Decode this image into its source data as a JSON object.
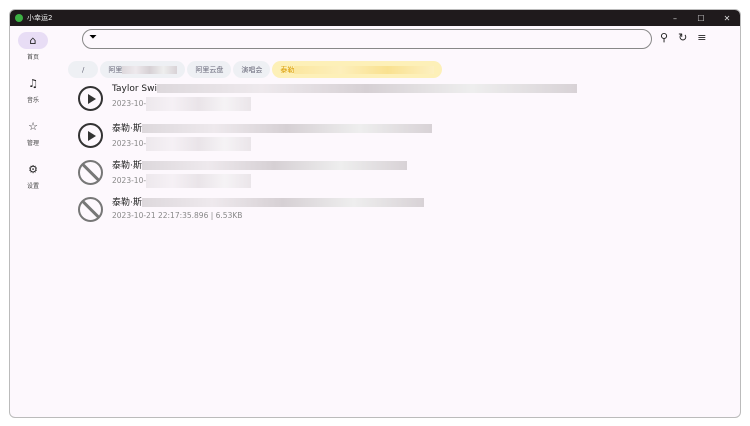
{
  "app": {
    "title": "小幸运2"
  },
  "window_controls": [
    "–",
    "☐",
    "✕"
  ],
  "sidebar": {
    "items": [
      {
        "label": "首页",
        "icon": "home-icon"
      },
      {
        "label": "音乐",
        "icon": "music-library-icon"
      },
      {
        "label": "管理",
        "icon": "star-icon"
      },
      {
        "label": "设置",
        "icon": "gear-icon"
      }
    ]
  },
  "toolbar": {
    "search_placeholder": "",
    "search_value": ""
  },
  "breadcrumbs": [
    "/",
    "阿里",
    "阿里云盘",
    "演唱会",
    "泰勒"
  ],
  "files": [
    {
      "name": "Taylor Swi",
      "meta": "2023-10-",
      "playable": true
    },
    {
      "name": "泰勒·斯",
      "meta": "2023-10-",
      "playable": true
    },
    {
      "name": "泰勒·斯",
      "meta": "2023-10-",
      "playable": false
    },
    {
      "name": "泰勒·斯",
      "meta": "2023-10-21 22:17:35.896 | 6.53KB",
      "playable": false
    }
  ]
}
